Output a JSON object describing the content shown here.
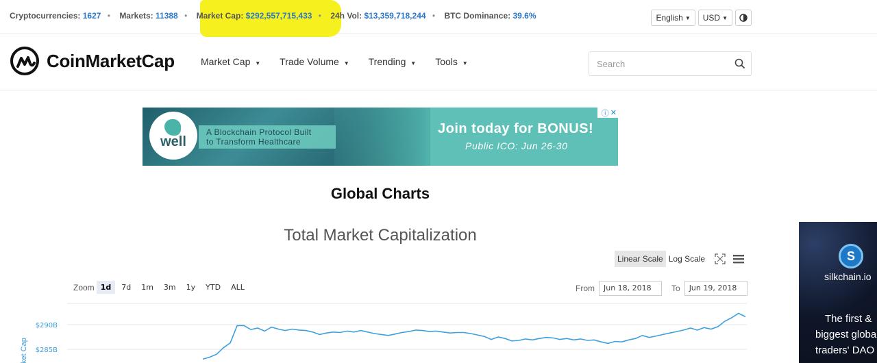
{
  "stats": {
    "cryptocurrencies_label": "Cryptocurrencies:",
    "cryptocurrencies_value": "1627",
    "markets_label": "Markets:",
    "markets_value": "11388",
    "market_cap_label": "Market Cap:",
    "market_cap_value": "$292,557,715,433",
    "vol_label": "24h Vol:",
    "vol_value": "$13,359,718,244",
    "btc_label": "BTC Dominance:",
    "btc_value": "39.6%",
    "separator": "•"
  },
  "topright": {
    "language": "English",
    "currency": "USD"
  },
  "brand": {
    "name": "CoinMarketCap"
  },
  "nav": {
    "items": [
      "Market Cap",
      "Trade Volume",
      "Trending",
      "Tools"
    ]
  },
  "search": {
    "placeholder": "Search"
  },
  "banner": {
    "logo_text": "well",
    "tagline_1": "A Blockchain Protocol Built",
    "tagline_2": "to Transform Healthcare",
    "headline": "Join today for BONUS!",
    "subline": "Public ICO: Jun 26-30"
  },
  "page": {
    "title": "Global Charts"
  },
  "chart": {
    "title": "Total Market Capitalization",
    "linear_label": "Linear Scale",
    "log_label": "Log Scale",
    "zoom_label": "Zoom",
    "zoom_options": [
      "1d",
      "7d",
      "1m",
      "3m",
      "1y",
      "YTD",
      "ALL"
    ],
    "zoom_selected": "1d",
    "from_label": "From",
    "from_value": "Jun 18, 2018",
    "to_label": "To",
    "to_value": "Jun 19, 2018",
    "ylabel": "Market Cap"
  },
  "chart_data": {
    "type": "line",
    "title": "Total Market Capitalization",
    "ylabel": "Market Cap",
    "yticks": [
      "$290B",
      "$285B"
    ],
    "yticks_values": [
      290,
      285
    ],
    "series": [
      {
        "values": [
          283,
          283.4,
          284,
          285.3,
          286.3,
          289.8,
          289.8,
          289.0,
          289.3,
          288.7,
          289.5,
          289.1,
          288.8,
          289.1,
          288.9,
          288.8,
          288.5,
          288.0,
          288.3,
          288.5,
          288.4,
          288.7,
          288.5,
          288.8,
          288.5,
          288.2,
          288.0,
          287.8,
          288.1,
          288.4,
          288.6,
          288.9,
          288.8,
          288.6,
          288.7,
          288.5,
          288.3,
          288.4,
          288.4,
          288.2,
          287.9,
          287.6,
          287.0,
          287.5,
          287.2,
          286.7,
          286.8,
          287.1,
          286.9,
          287.2,
          287.4,
          287.3,
          287.0,
          287.2,
          286.9,
          287.1,
          286.8,
          286.9,
          286.5,
          286.2,
          286.6,
          286.5,
          286.9,
          287.2,
          287.8,
          287.4,
          287.7,
          288.0,
          288.3,
          288.6,
          288.9,
          289.3,
          288.9,
          289.4,
          289.1,
          289.6,
          290.7,
          291.4,
          292.3,
          291.6
        ],
        "color": "#3ea0dc"
      }
    ],
    "ylim": [
      283,
      292.5
    ],
    "grid": true
  },
  "side_ad": {
    "brand": "silkchain.io",
    "coin_symbol": "S",
    "line1": "The first &",
    "line2": "biggest global",
    "line3": "traders' DAO"
  }
}
